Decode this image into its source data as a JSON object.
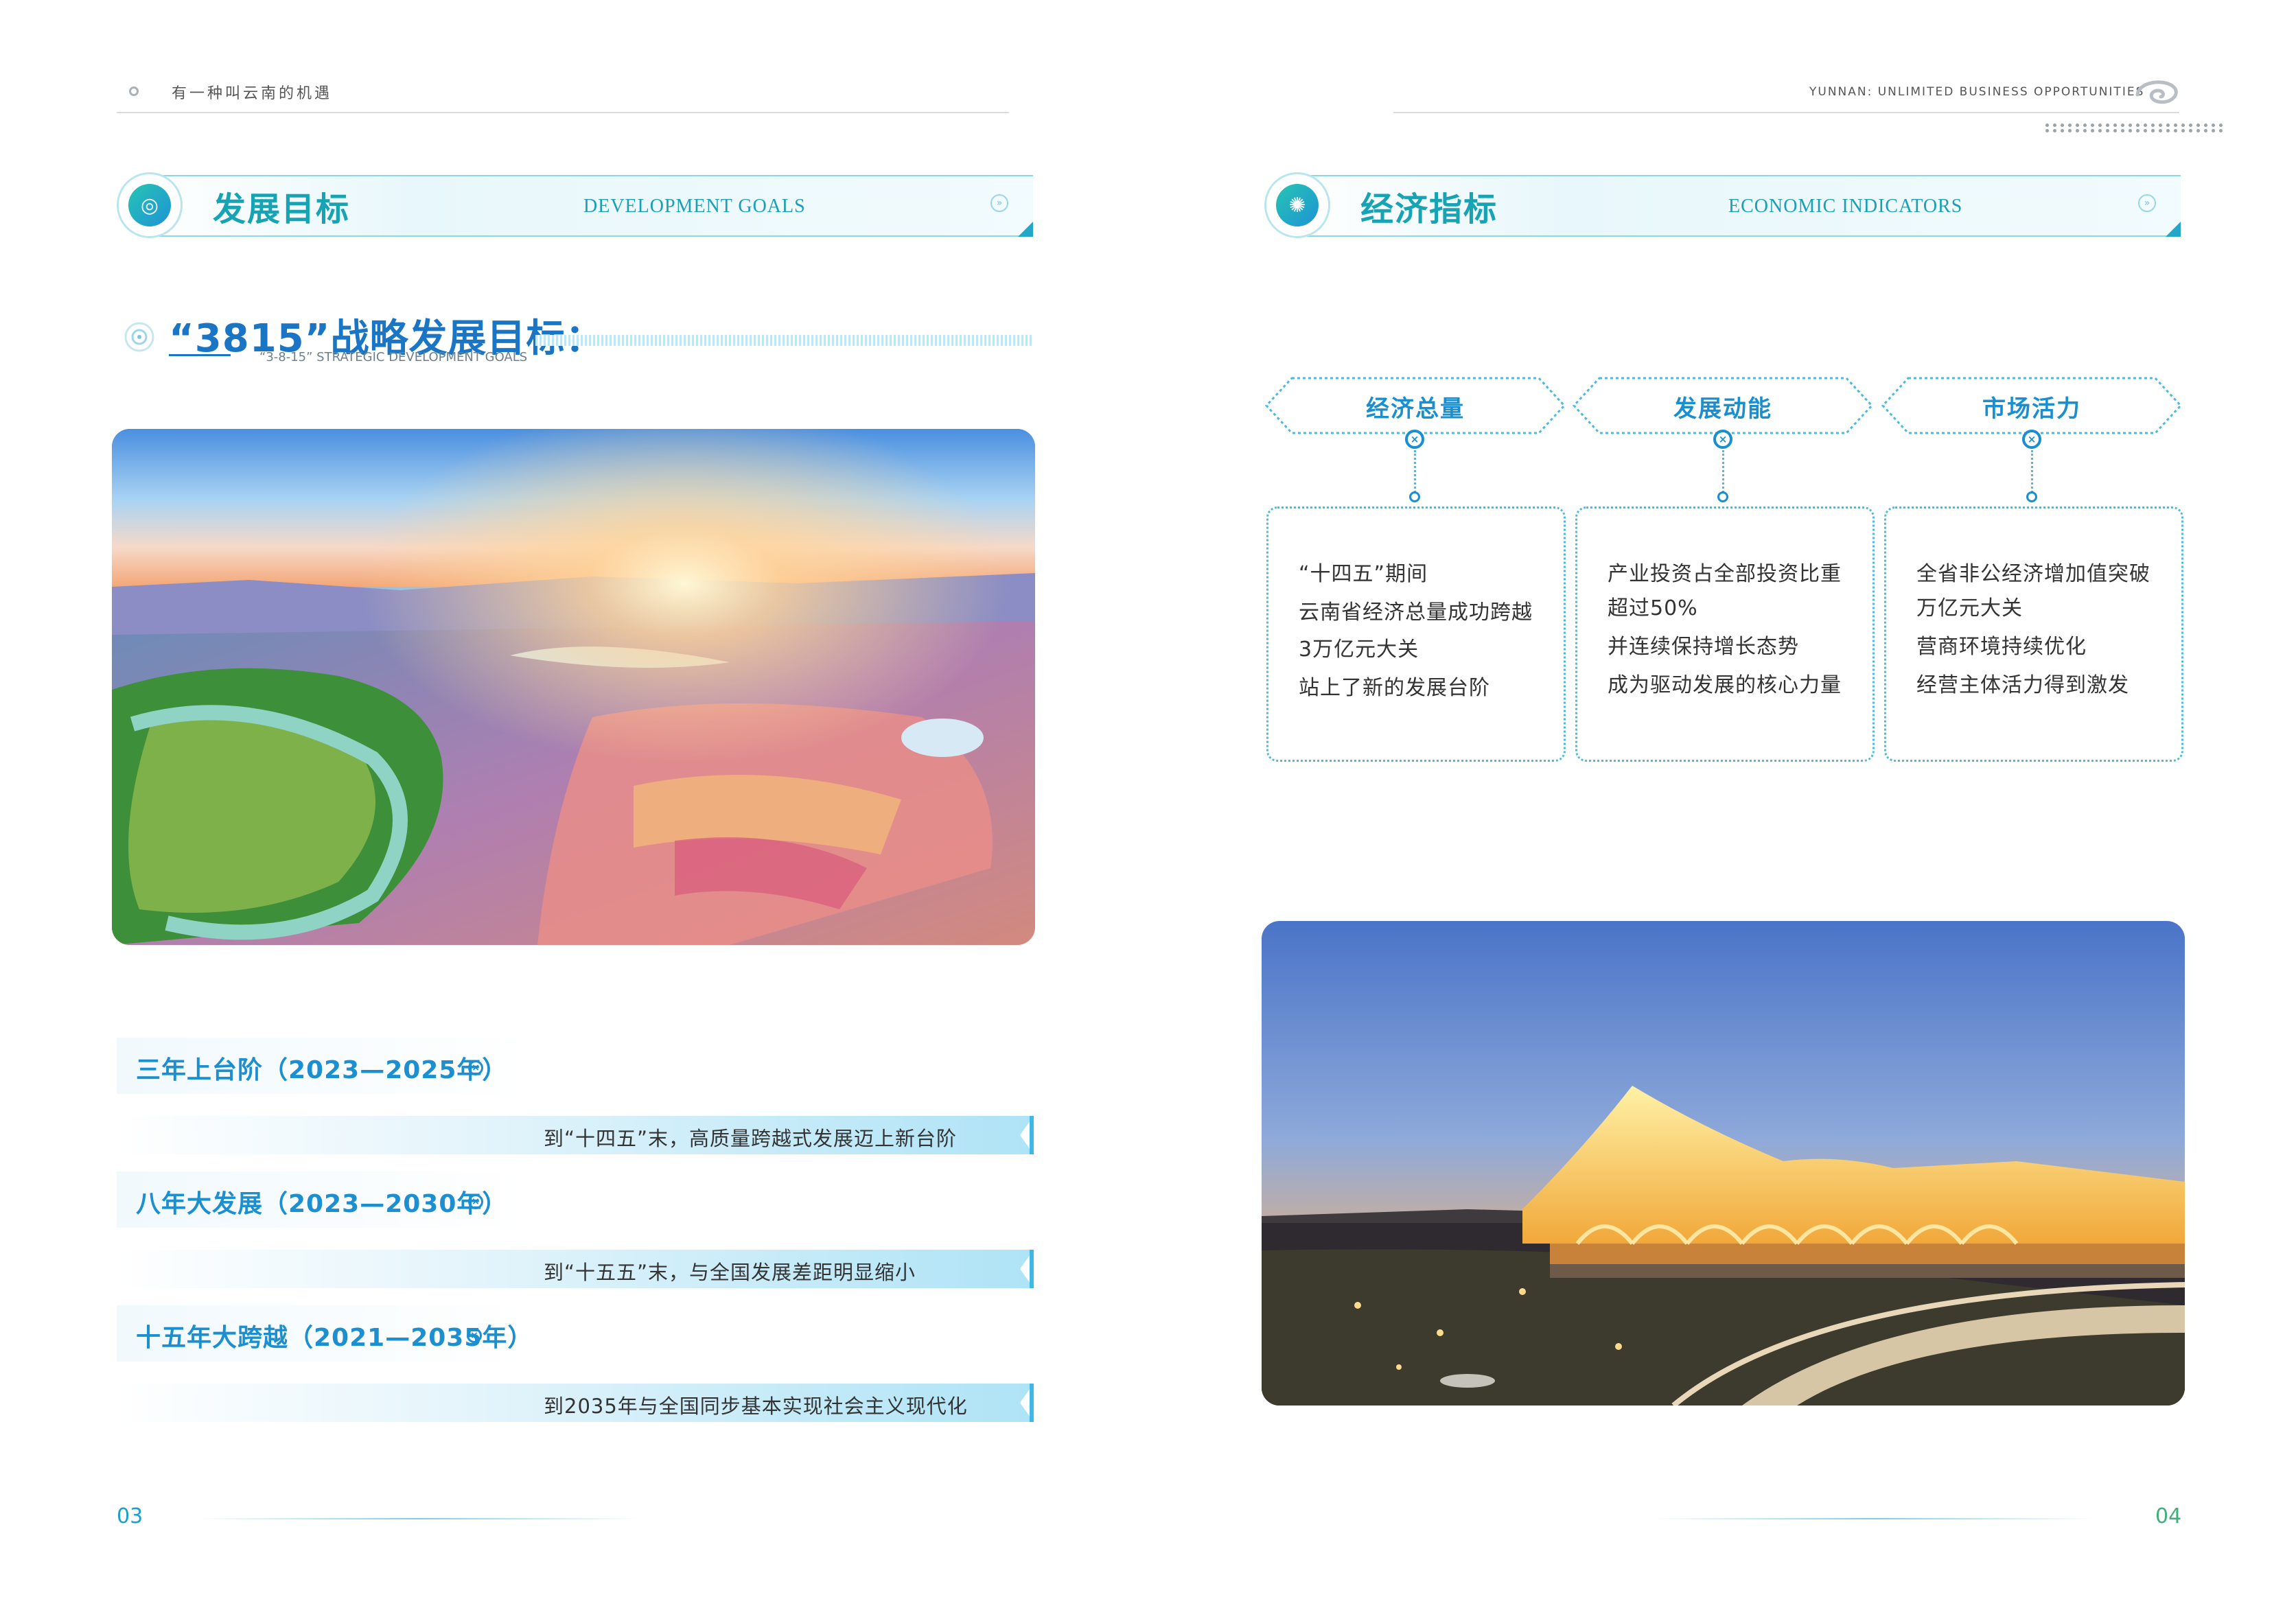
{
  "header": {
    "left_title": "有一种叫云南的机遇",
    "right_title": "YUNNAN: UNLIMITED BUSINESS OPPORTUNITIES"
  },
  "left": {
    "section_cn": "发展目标",
    "section_en": "DEVELOPMENT GOALS",
    "strategy_title": "“3815”战略发展目标：",
    "strategy_subtitle": "“3-8-15” STRATEGIC DEVELOPMENT GOALS",
    "goals": [
      {
        "label": "三年上台阶（2023—2025年）",
        "text": "到“十四五”末，高质量跨越式发展迈上新台阶"
      },
      {
        "label": "八年大发展（2023—2030年）",
        "text": "到“十五五”末，与全国发展差距明显缩小"
      },
      {
        "label": "十五年大跨越（2021—2035年）",
        "text": "到2035年与全国同步基本实现社会主义现代化"
      }
    ],
    "page_number": "03"
  },
  "right": {
    "section_cn": "经济指标",
    "section_en": "ECONOMIC INDICATORS",
    "indicators": [
      {
        "title": "经济总量",
        "lines": [
          "“十四五”期间",
          "云南省经济总量成功跨越",
          "3万亿元大关",
          "站上了新的发展台阶"
        ]
      },
      {
        "title": "发展动能",
        "lines": [
          "产业投资占全部投资比重",
          "超过50%",
          "并连续保持增长态势",
          "成为驱动发展的核心力量"
        ]
      },
      {
        "title": "市场活力",
        "lines": [
          "全省非公经济增加值突破",
          "万亿元大关",
          "营商环境持续优化",
          "经营主体活力得到激发"
        ]
      }
    ],
    "page_number": "04"
  },
  "colors": {
    "accent": "#1a8fd0",
    "teal": "#16a3b4",
    "light_blue": "#aee3f6"
  }
}
